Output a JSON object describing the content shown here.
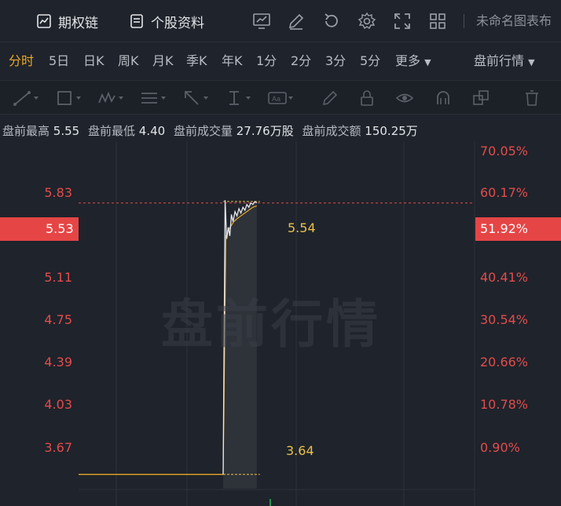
{
  "toolbar": {
    "option_chain": "期权链",
    "stock_profile": "个股资料",
    "chart_name": "未命名图表布"
  },
  "tabs": [
    {
      "label": "分时",
      "active": true
    },
    {
      "label": "5日"
    },
    {
      "label": "日K"
    },
    {
      "label": "周K"
    },
    {
      "label": "月K"
    },
    {
      "label": "季K"
    },
    {
      "label": "年K"
    },
    {
      "label": "1分"
    },
    {
      "label": "2分"
    },
    {
      "label": "3分"
    },
    {
      "label": "5分"
    },
    {
      "label": "更多"
    },
    {
      "label": "盘前行情"
    }
  ],
  "stats": {
    "high_label": "盘前最高",
    "high_value": "5.55",
    "low_label": "盘前最低",
    "low_value": "4.40",
    "volume_label": "盘前成交量",
    "volume_value": "27.76万股",
    "amount_label": "盘前成交额",
    "amount_value": "150.25万"
  },
  "watermark": "盘前行情",
  "chart_data": {
    "type": "line",
    "y_left_ticks": [
      "5.83",
      "5.11",
      "4.75",
      "4.39",
      "4.03",
      "3.67"
    ],
    "y_right_ticks": [
      "70.05%",
      "60.17%",
      "40.41%",
      "30.54%",
      "20.66%",
      "10.78%",
      "0.90%"
    ],
    "current_price": "5.53",
    "current_pct": "51.92%",
    "high_annotation": "5.54",
    "low_annotation": "3.64",
    "y_range": [
      3.42,
      5.96
    ],
    "x_range": [
      0,
      100
    ],
    "x_split": 36.5,
    "series": [
      {
        "x": [
          0,
          36.5
        ],
        "values": [
          3.64,
          3.64
        ]
      },
      {
        "x": [
          36.5,
          37.0,
          37.4,
          37.8,
          38.2,
          38.6,
          39.0,
          39.5,
          40.0,
          40.5,
          41.0,
          41.5,
          42.0,
          42.5,
          43.0,
          43.5,
          44.0,
          44.5,
          45.0
        ],
        "values": [
          3.64,
          5.55,
          5.28,
          5.36,
          5.3,
          5.45,
          5.4,
          5.47,
          5.44,
          5.49,
          5.46,
          5.5,
          5.48,
          5.52,
          5.5,
          5.53,
          5.52,
          5.54,
          5.53
        ]
      },
      {
        "x": [
          36.5,
          37.2,
          37.8,
          38.5,
          39.2,
          40.0,
          41.0,
          42.0,
          43.0,
          44.0,
          45.0
        ],
        "values": [
          3.64,
          5.3,
          5.34,
          5.37,
          5.4,
          5.42,
          5.44,
          5.46,
          5.48,
          5.5,
          5.51
        ]
      }
    ],
    "colors": {
      "price_line": "#e6e8ec",
      "avg_line": "#e8a927",
      "pre_line": "#e8a927",
      "label_red": "#e24c4c",
      "annotation": "#e8c24a"
    }
  }
}
